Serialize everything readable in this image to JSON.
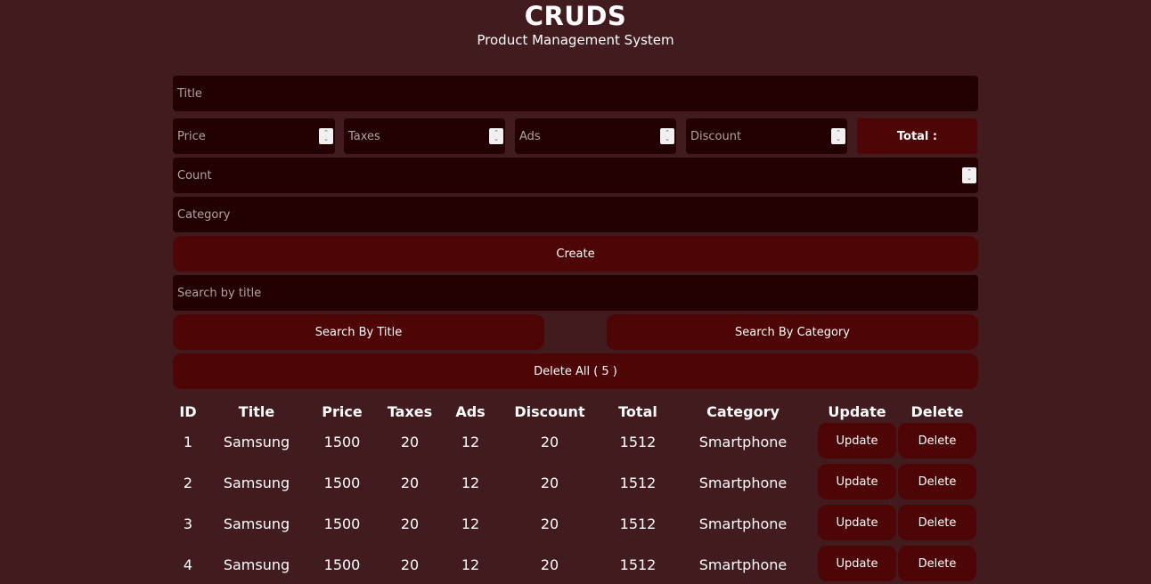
{
  "header": {
    "title": "CRUDS",
    "subtitle": "Product Management System"
  },
  "form": {
    "title_placeholder": "Title",
    "price_placeholder": "Price",
    "taxes_placeholder": "Taxes",
    "ads_placeholder": "Ads",
    "discount_placeholder": "Discount",
    "total_label": "Total :",
    "count_placeholder": "Count",
    "category_placeholder": "Category",
    "create_label": "Create"
  },
  "search": {
    "placeholder": "Search by title",
    "by_title_label": "Search By Title",
    "by_category_label": "Search By Category",
    "delete_all_label": "Delete All ( 5 )"
  },
  "table": {
    "headers": [
      "ID",
      "Title",
      "Price",
      "Taxes",
      "Ads",
      "Discount",
      "Total",
      "Category",
      "Update",
      "Delete"
    ],
    "rows": [
      {
        "id": "1",
        "title": "Samsung",
        "price": "1500",
        "taxes": "20",
        "ads": "12",
        "discount": "20",
        "total": "1512",
        "category": "Smartphone",
        "update": "Update",
        "delete": "Delete"
      },
      {
        "id": "2",
        "title": "Samsung",
        "price": "1500",
        "taxes": "20",
        "ads": "12",
        "discount": "20",
        "total": "1512",
        "category": "Smartphone",
        "update": "Update",
        "delete": "Delete"
      },
      {
        "id": "3",
        "title": "Samsung",
        "price": "1500",
        "taxes": "20",
        "ads": "12",
        "discount": "20",
        "total": "1512",
        "category": "Smartphone",
        "update": "Update",
        "delete": "Delete"
      },
      {
        "id": "4",
        "title": "Samsung",
        "price": "1500",
        "taxes": "20",
        "ads": "12",
        "discount": "20",
        "total": "1512",
        "category": "Smartphone",
        "update": "Update",
        "delete": "Delete"
      }
    ]
  },
  "colors": {
    "background": "#421b1e",
    "input_bg": "#230000",
    "button_bg": "#4d0505",
    "text": "#ffffff"
  }
}
